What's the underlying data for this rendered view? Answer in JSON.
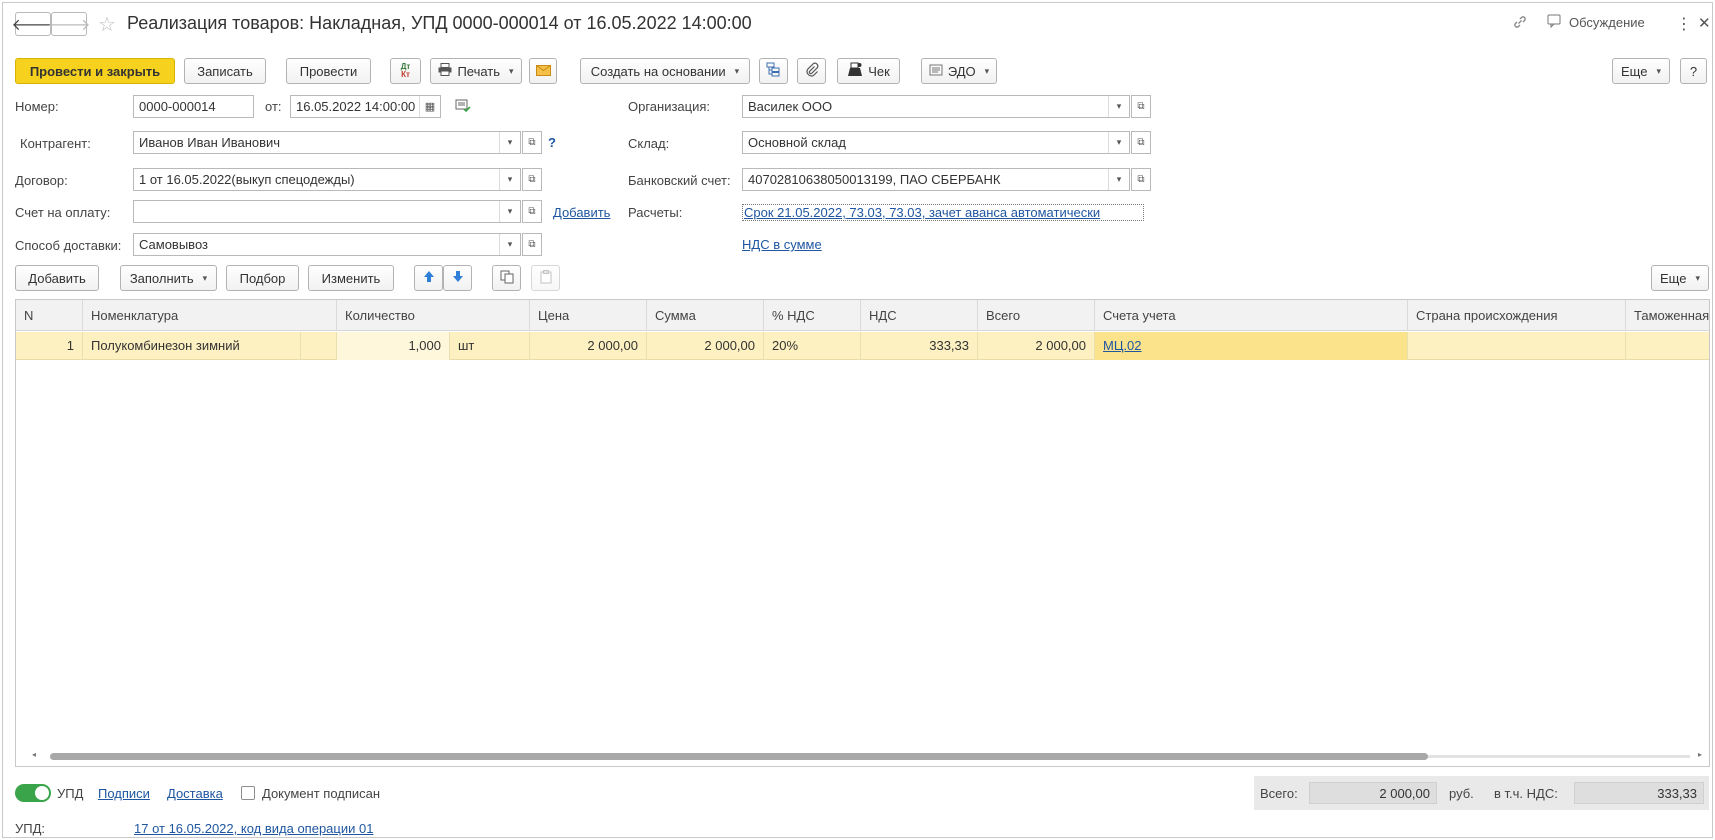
{
  "window": {
    "title": "Реализация товаров: Накладная, УПД 0000-000014 от 16.05.2022 14:00:00",
    "discussion_label": "Обсуждение"
  },
  "toolbar": {
    "post_close": "Провести и закрыть",
    "save": "Записать",
    "post": "Провести",
    "dtkt": "Дт Кт",
    "print": "Печать",
    "create_based": "Создать на основании",
    "receipt": "Чек",
    "edo": "ЭДО",
    "more": "Еще",
    "help": "?"
  },
  "form": {
    "number_label": "Номер:",
    "number_value": "0000-000014",
    "from_label": "от:",
    "date_value": "16.05.2022 14:00:00",
    "counterparty_label": "Контрагент:",
    "counterparty_value": "Иванов Иван Иванович",
    "counterparty_help": "?",
    "contract_label": "Договор:",
    "contract_value": "1 от 16.05.2022(выкуп спецодежды)",
    "invoice_label": "Счет на оплату:",
    "invoice_value": "",
    "invoice_add_link": "Добавить",
    "delivery_label": "Способ доставки:",
    "delivery_value": "Самовывоз",
    "org_label": "Организация:",
    "org_value": "Василек ООО",
    "warehouse_label": "Склад:",
    "warehouse_value": "Основной склад",
    "bank_label": "Банковский счет:",
    "bank_value": "40702810638050013199, ПАО СБЕРБАНК",
    "settlements_label": "Расчеты:",
    "settlements_link": "Срок 21.05.2022, 73.03, 73.03, зачет аванса автоматически",
    "vat_link": "НДС в сумме"
  },
  "table_toolbar": {
    "add": "Добавить",
    "fill": "Заполнить",
    "pick": "Подбор",
    "change": "Изменить",
    "more": "Еще"
  },
  "table": {
    "columns": [
      "N",
      "Номенклатура",
      "Количество",
      "Цена",
      "Сумма",
      "% НДС",
      "НДС",
      "Всего",
      "Счета учета",
      "Страна происхождения",
      "Таможенная"
    ],
    "rows": [
      {
        "n": "1",
        "item": "Полукомбинезон зимний",
        "qty": "1,000",
        "unit": "шт",
        "price": "2 000,00",
        "sum": "2 000,00",
        "vat_rate": "20%",
        "vat": "333,33",
        "total": "2 000,00",
        "account": "МЦ.02",
        "country": "",
        "customs": ""
      }
    ]
  },
  "footer": {
    "upd_toggle_label": "УПД",
    "signatures_link": "Подписи",
    "delivery_link": "Доставка",
    "signed_label": "Документ подписан",
    "total_label": "Всего:",
    "total_value": "2 000,00",
    "currency": "руб.",
    "vat_incl_label": "в т.ч. НДС:",
    "vat_value": "333,33",
    "upd_label": "УПД:",
    "upd_link": "17 от 16.05.2022, код вида операции 01"
  },
  "colors": {
    "primary_button": "#f6d21e",
    "selected_row": "#fdf1c2",
    "link": "#1f56a0",
    "toggle_on": "#3aa44a"
  }
}
